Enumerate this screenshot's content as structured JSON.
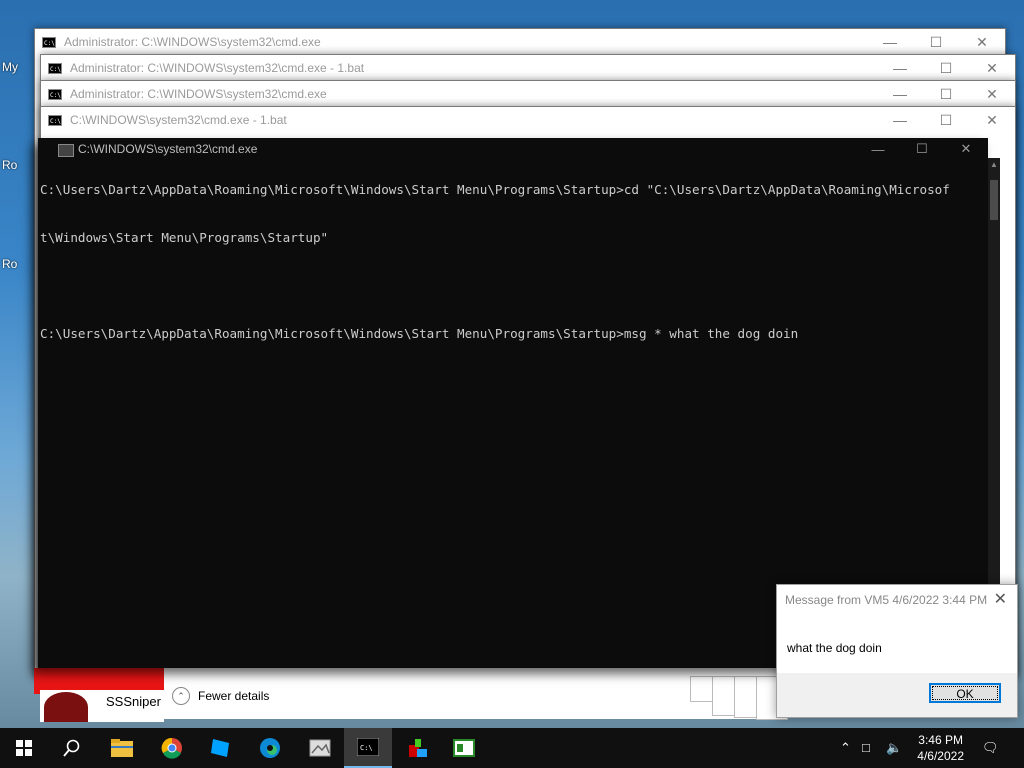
{
  "desktop": {
    "icon_labels": [
      "My",
      "Ro",
      "Ro"
    ]
  },
  "windows": [
    {
      "title": "Administrator: C:\\WINDOWS\\system32\\cmd.exe"
    },
    {
      "title": "Administrator: C:\\WINDOWS\\system32\\cmd.exe - 1.bat"
    },
    {
      "title": "Administrator: C:\\WINDOWS\\system32\\cmd.exe"
    },
    {
      "title": "C:\\WINDOWS\\system32\\cmd.exe - 1.bat"
    }
  ],
  "console": {
    "title": "C:\\WINDOWS\\system32\\cmd.exe",
    "lines": [
      "C:\\Users\\Dartz\\AppData\\Roaming\\Microsoft\\Windows\\Start Menu\\Programs\\Startup>cd \"C:\\Users\\Dartz\\AppData\\Roaming\\Microsof",
      "t\\Windows\\Start Menu\\Programs\\Startup\"",
      "",
      "C:\\Users\\Dartz\\AppData\\Roaming\\Microsoft\\Windows\\Start Menu\\Programs\\Startup>msg * what the dog doin"
    ]
  },
  "dialog": {
    "title": "Message from VM5 4/6/2022 3:44 PM",
    "message": "what the dog doin",
    "ok_label": "OK"
  },
  "task_manager": {
    "fewer_details_label": "Fewer details"
  },
  "gamer": {
    "name": "SSSniper"
  },
  "taskbar": {
    "time": "3:46 PM",
    "date": "4/6/2022",
    "accent": "#76b9ed"
  }
}
